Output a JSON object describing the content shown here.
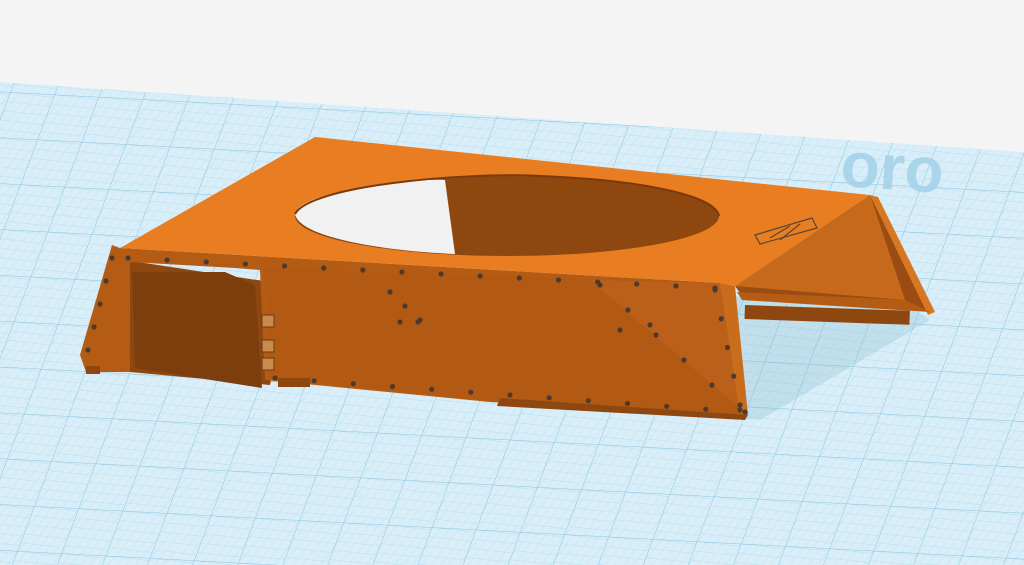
{
  "workplane": {
    "corner_text": "oro",
    "grid_color": "#bfe2f2",
    "grid_line_color": "#8dc8e4",
    "background": "#f4f4f4"
  },
  "model": {
    "name": "",
    "top_color": "#e87d22",
    "side_color": "#b55c14",
    "inner_color": "#8f4710",
    "rivet_color": "#4d3a2c"
  }
}
